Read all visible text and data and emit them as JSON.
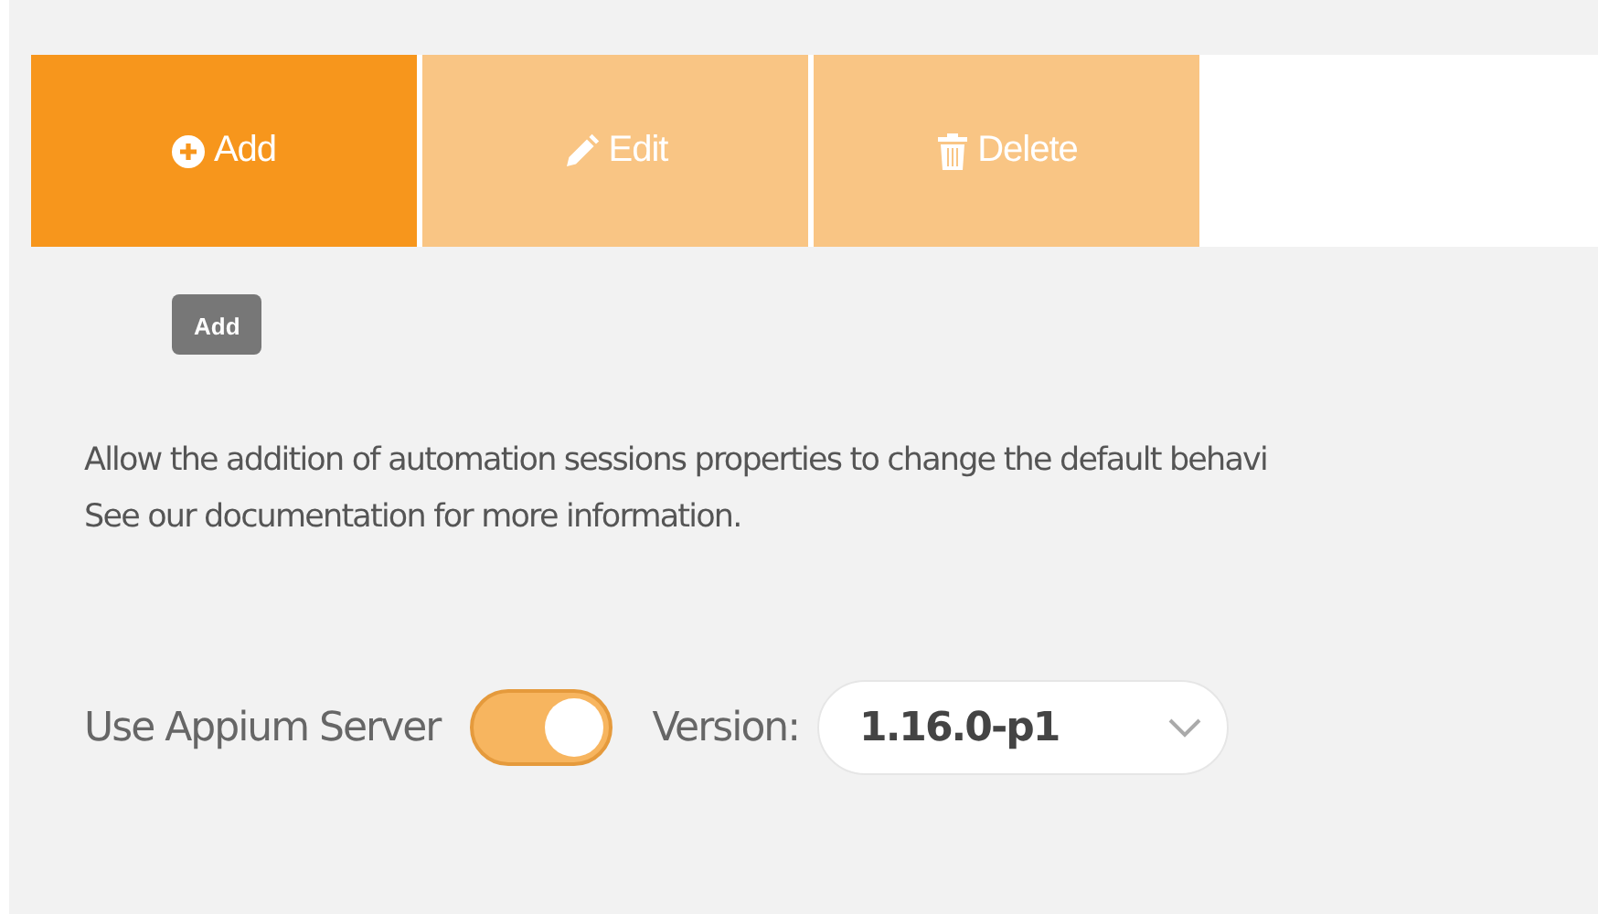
{
  "toolbar": {
    "buttons": [
      {
        "kind": "add",
        "label": "Add",
        "disabled": false
      },
      {
        "kind": "edit",
        "label": "Edit",
        "disabled": true
      },
      {
        "kind": "delete",
        "label": "Delete",
        "disabled": true
      }
    ]
  },
  "tooltip": "Add",
  "description": [
    "Allow the addition of automation sessions properties to change the default behavi",
    "See our documentation for more information."
  ],
  "appium": {
    "label": "Use Appium Server",
    "on": true,
    "version_label": "Version:",
    "version": "1.16.0-p1"
  }
}
